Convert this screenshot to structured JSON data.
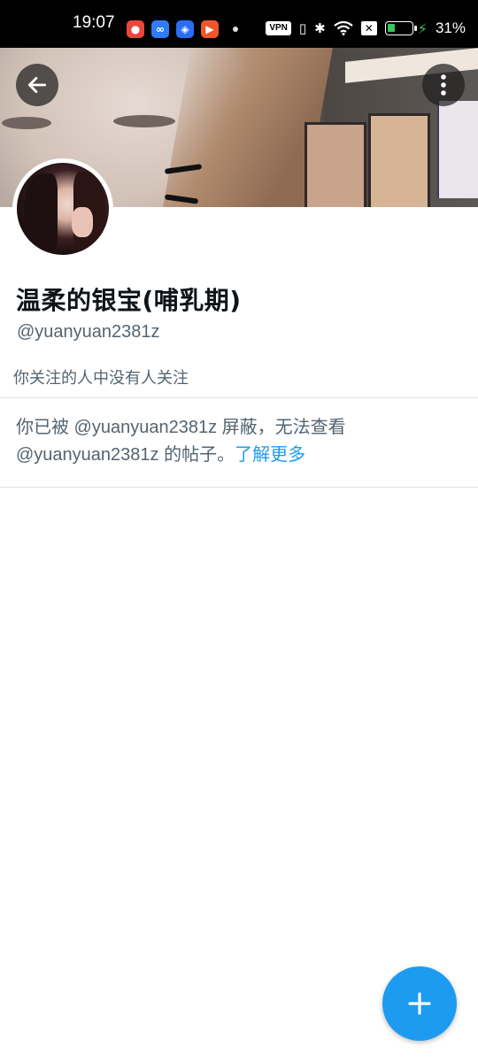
{
  "status_bar": {
    "time": "19:07",
    "notification_icons": [
      {
        "name": "app-red-icon",
        "color": "#e8473a"
      },
      {
        "name": "app-infinity-icon",
        "color": "#2f7cf6"
      },
      {
        "name": "app-shield-icon",
        "color": "#2a6df4"
      },
      {
        "name": "app-play-icon",
        "color": "#f0562a"
      }
    ],
    "vpn_label": "VPN",
    "battery_percent": "31%",
    "battery_level": 0.31
  },
  "header": {
    "back_icon": "arrow-left-icon",
    "more_icon": "more-vertical-icon"
  },
  "profile": {
    "display_name": "温柔的银宝(哺乳期)",
    "handle": "@yuanyuan2381z",
    "followers_you_know": "你关注的人中没有人关注"
  },
  "blocked_notice": {
    "text": "你已被 @yuanyuan2381z 屏蔽，无法查看 @yuanyuan2381z 的帖子。",
    "learn_more": "了解更多"
  },
  "fab": {
    "icon": "plus-icon",
    "color": "#1d9bf0"
  }
}
